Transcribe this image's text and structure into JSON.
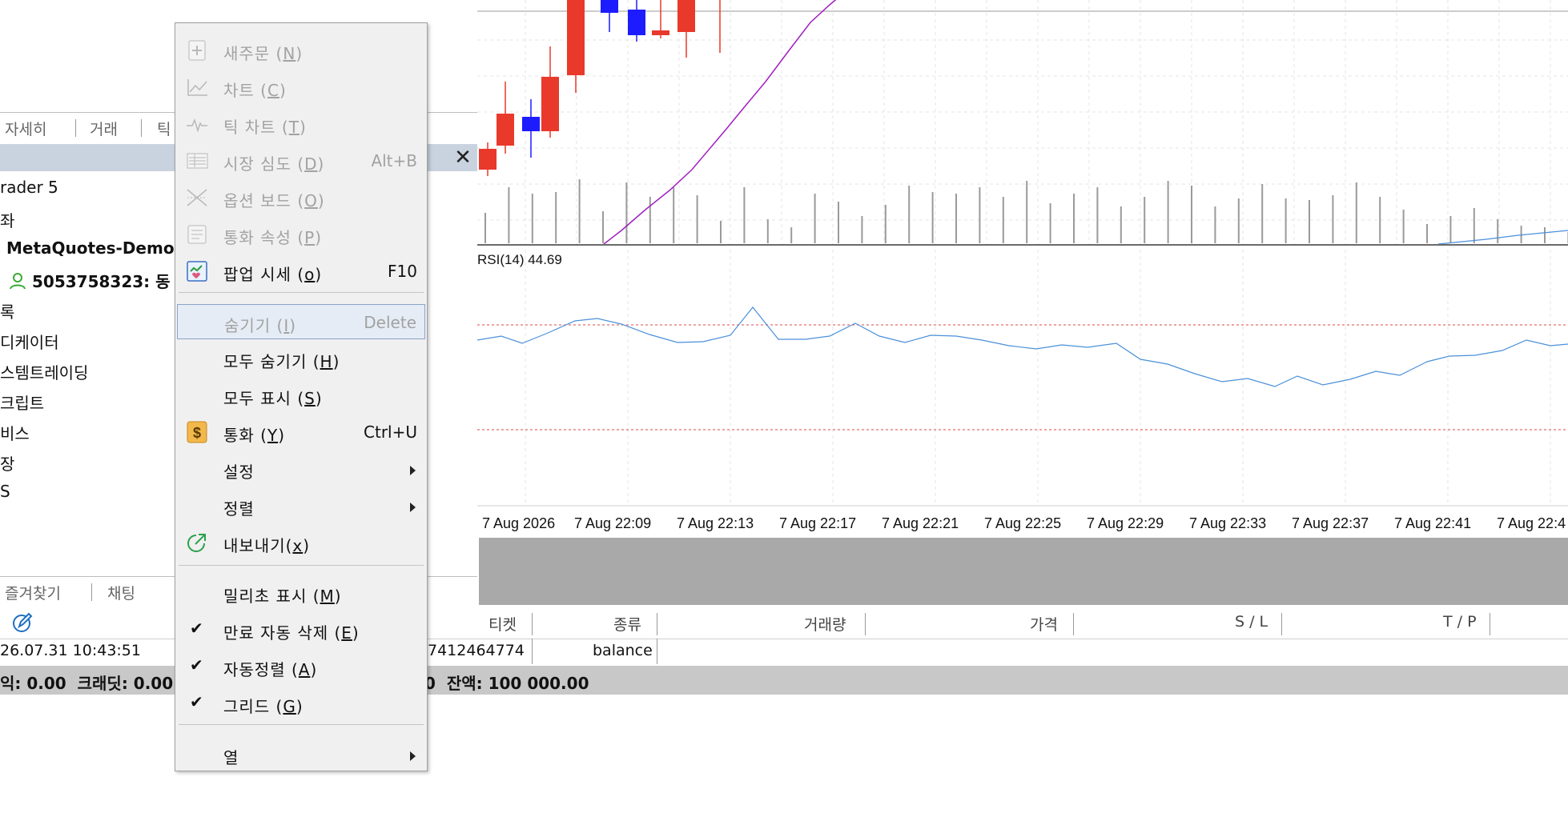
{
  "navigator": {
    "top_tabs": [
      "자세히",
      "거래",
      "틱"
    ],
    "tree": [
      "rader 5",
      "좌",
      "MetaQuotes-Demo",
      "5053758323: 동",
      "록",
      "디케이터",
      "스템트레이딩",
      "크립트",
      "비스",
      "장",
      "S"
    ],
    "bottom_tabs": [
      "즐겨찾기",
      "채팅"
    ]
  },
  "chart": {
    "indicator_label": "RSI(14) 44.69",
    "time_labels": [
      "7 Aug 2026",
      "7 Aug 22:09",
      "7 Aug 22:13",
      "7 Aug 22:17",
      "7 Aug 22:21",
      "7 Aug 22:25",
      "7 Aug 22:29",
      "7 Aug 22:33",
      "7 Aug 22:37",
      "7 Aug 22:41",
      "7 Aug 22:4"
    ],
    "colors": {
      "bull": "#e8392b",
      "bear": "#1c1cff",
      "ma": "#a020c0",
      "rsi": "#4a90d9",
      "level": "#d94848"
    }
  },
  "table": {
    "columns": [
      "티켓",
      "종류",
      "거래량",
      "가격",
      "S / L",
      "T / P"
    ],
    "row": {
      "time": "26.07.31 10:43:51",
      "ticket": "7412464774",
      "type": "balance"
    },
    "status_text": "익: 0.00  크래딧: 0.00",
    "status_right": "0  잔액: 100 000.00"
  },
  "menu": {
    "items": [
      {
        "label": "새주문 (",
        "key": "N",
        "tail": ")",
        "shortcut": "",
        "disabled": true,
        "icon": "new-order-icon"
      },
      {
        "label": "차트 (",
        "key": "C",
        "tail": ")",
        "shortcut": "",
        "disabled": true,
        "icon": "chart-icon"
      },
      {
        "label": "틱 차트 (",
        "key": "T",
        "tail": ")",
        "shortcut": "",
        "disabled": true,
        "icon": "tick-chart-icon"
      },
      {
        "label": "시장 심도 (",
        "key": "D",
        "tail": ")",
        "shortcut": "Alt+B",
        "disabled": true,
        "icon": "market-depth-icon"
      },
      {
        "label": "옵션 보드 (",
        "key": "O",
        "tail": ")",
        "shortcut": "",
        "disabled": true,
        "icon": "option-board-icon"
      },
      {
        "label": "통화 속성 (",
        "key": "P",
        "tail": ")",
        "shortcut": "",
        "disabled": true,
        "icon": "properties-icon"
      },
      {
        "label": "팝업 시세 (",
        "key": "o",
        "tail": ")",
        "shortcut": "F10",
        "disabled": false,
        "icon": "popup-prices-icon"
      },
      {
        "label": "숨기기 (",
        "key": "I",
        "tail": ")",
        "shortcut": "Delete",
        "disabled": true,
        "icon": ""
      },
      {
        "label": "모두 숨기기 (",
        "key": "H",
        "tail": ")",
        "shortcut": "",
        "disabled": false,
        "icon": ""
      },
      {
        "label": "모두 표시 (",
        "key": "S",
        "tail": ")",
        "shortcut": "",
        "disabled": false,
        "icon": ""
      },
      {
        "label": "통화 (",
        "key": "Y",
        "tail": ")",
        "shortcut": "Ctrl+U",
        "disabled": false,
        "icon": "dollar-icon"
      },
      {
        "label": "설정",
        "key": "",
        "tail": "",
        "shortcut": "",
        "disabled": false,
        "icon": ""
      },
      {
        "label": "정렬",
        "key": "",
        "tail": "",
        "shortcut": "",
        "disabled": false,
        "icon": ""
      },
      {
        "label": "내보내기(",
        "key": "x",
        "tail": ")",
        "shortcut": "",
        "disabled": false,
        "icon": "export-icon"
      },
      {
        "label": "밀리초 표시 (",
        "key": "M",
        "tail": ")",
        "shortcut": "",
        "disabled": false,
        "icon": ""
      },
      {
        "label": "만료 자동 삭제 (",
        "key": "E",
        "tail": ")",
        "shortcut": "",
        "disabled": false,
        "icon": ""
      },
      {
        "label": "자동정렬 (",
        "key": "A",
        "tail": ")",
        "shortcut": "",
        "disabled": false,
        "icon": ""
      },
      {
        "label": "그리드 (",
        "key": "G",
        "tail": ")",
        "shortcut": "",
        "disabled": false,
        "icon": ""
      },
      {
        "label": "열",
        "key": "",
        "tail": "",
        "shortcut": "",
        "disabled": false,
        "icon": ""
      }
    ]
  }
}
